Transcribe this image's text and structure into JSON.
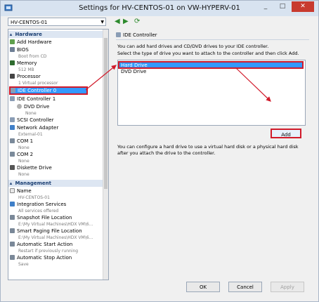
{
  "window": {
    "title": "Settings for HV-CENTOS-01 on VW-HYPERV-01"
  },
  "toolbar": {
    "vm_name": "HV-CENTOS-01"
  },
  "sidebar": {
    "hardware_header": "Hardware",
    "management_header": "Management",
    "items": [
      {
        "label": "Add Hardware",
        "sub": ""
      },
      {
        "label": "BIOS",
        "sub": "Boot from CD"
      },
      {
        "label": "Memory",
        "sub": "512 MB"
      },
      {
        "label": "Processor",
        "sub": "1 Virtual processor"
      },
      {
        "label": "IDE Controller 0",
        "sub": ""
      },
      {
        "label": "IDE Controller 1",
        "sub": ""
      },
      {
        "label": "DVD Drive",
        "sub": "None"
      },
      {
        "label": "SCSI Controller",
        "sub": ""
      },
      {
        "label": "Network Adapter",
        "sub": "External-01"
      },
      {
        "label": "COM 1",
        "sub": "None"
      },
      {
        "label": "COM 2",
        "sub": "None"
      },
      {
        "label": "Diskette Drive",
        "sub": "None"
      }
    ],
    "mgmt_items": [
      {
        "label": "Name",
        "sub": "HV-CENTOS-01"
      },
      {
        "label": "Integration Services",
        "sub": "All services offered"
      },
      {
        "label": "Snapshot File Location",
        "sub": "E:\\My Virtual Machines\\HDX VM\\6..."
      },
      {
        "label": "Smart Paging File Location",
        "sub": "E:\\My Virtual Machines\\HDX VM\\6..."
      },
      {
        "label": "Automatic Start Action",
        "sub": "Restart if previously running"
      },
      {
        "label": "Automatic Stop Action",
        "sub": "Save"
      }
    ]
  },
  "panel": {
    "title": "IDE Controller",
    "text1": "You can add hard drives and CD/DVD drives to your IDE controller.",
    "text2": "Select the type of drive you want to attach to the controller and then click Add.",
    "options": [
      "Hard Drive",
      "DVD Drive"
    ],
    "add_label": "Add",
    "text3": "You can configure a hard drive to use a virtual hard disk or a physical hard disk after you attach the drive to the controller."
  },
  "buttons": {
    "ok": "OK",
    "cancel": "Cancel",
    "apply": "Apply"
  },
  "colors": {
    "selection": "#3399ff",
    "highlight_box": "#d11a2a"
  }
}
